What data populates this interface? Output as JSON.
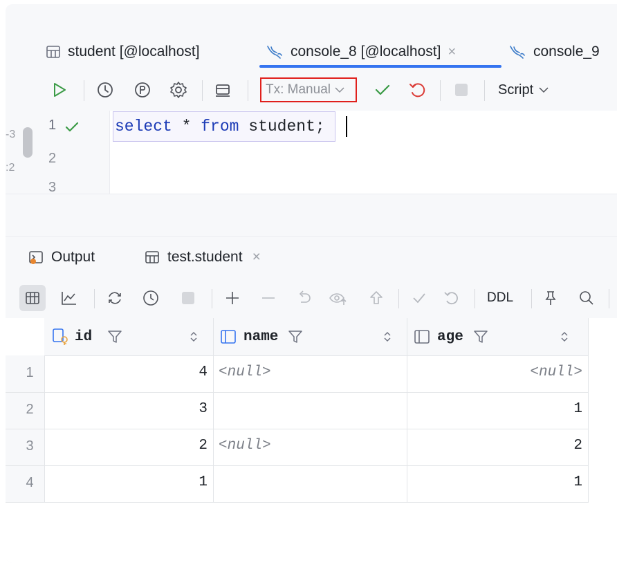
{
  "tabs": {
    "student": {
      "label": "student [@localhost]"
    },
    "console8": {
      "label": "console_8 [@localhost]",
      "close": "×"
    },
    "console9": {
      "label": "console_9"
    }
  },
  "toolbar": {
    "tx_mode": "Tx: Manual",
    "script_label": "Script",
    "highlight_color": "#e0201c"
  },
  "gutter_left": {
    "frag1": "-3",
    "frag2": ":2"
  },
  "editor": {
    "lines": [
      {
        "num": "1",
        "kw1": "select",
        "op": " * ",
        "kw2": "from",
        "rest": " student;"
      },
      {
        "num": "2"
      },
      {
        "num": "3"
      }
    ]
  },
  "bottom_tabs": {
    "output": "Output",
    "result": "test.student",
    "close": "×"
  },
  "result_toolbar": {
    "ddl": "DDL"
  },
  "table": {
    "columns": [
      {
        "name": "id",
        "icon": "key-column-icon"
      },
      {
        "name": "name",
        "icon": "column-icon"
      },
      {
        "name": "age",
        "icon": "column-icon"
      }
    ],
    "rows": [
      {
        "n": "1",
        "id": "4",
        "name": "<null>",
        "age": "<null>"
      },
      {
        "n": "2",
        "id": "3",
        "name": "",
        "age": "1"
      },
      {
        "n": "3",
        "id": "2",
        "name": "<null>",
        "age": "2"
      },
      {
        "n": "4",
        "id": "1",
        "name": "",
        "age": "1"
      }
    ]
  }
}
